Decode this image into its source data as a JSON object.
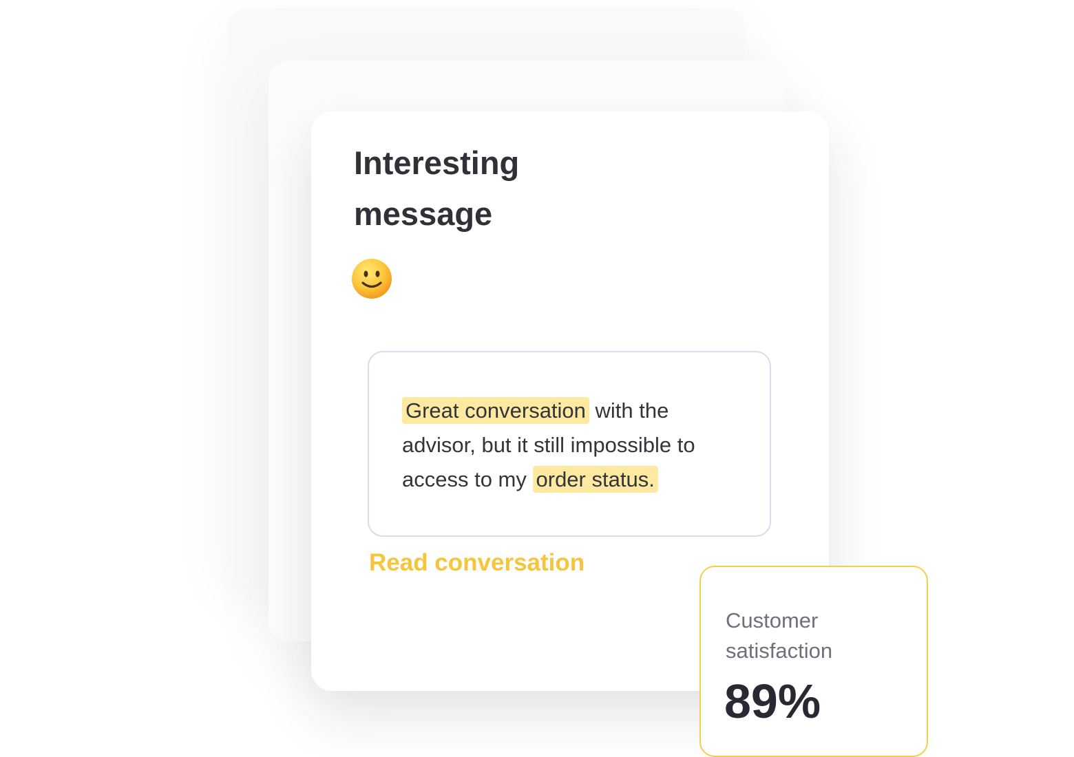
{
  "card": {
    "title": "Interesting message",
    "emoji_icon": "slightly-smiling-face-icon"
  },
  "quote": {
    "highlight_1": "Great conversation",
    "text_1": " with the advisor, but it still impossible to access to my ",
    "highlight_2": "order status."
  },
  "actions": {
    "read_conversation": "Read conversation"
  },
  "stat": {
    "label": "Customer satisfaction",
    "value": "89%",
    "percent": 89
  },
  "colors": {
    "accent": "#f5c53c",
    "highlight": "#fdeaa0",
    "title_text": "#2f3137",
    "body_text": "#33343a",
    "muted_text": "#6f717a",
    "stat_border": "#f5cf4a",
    "quote_border": "#d6dde6"
  }
}
